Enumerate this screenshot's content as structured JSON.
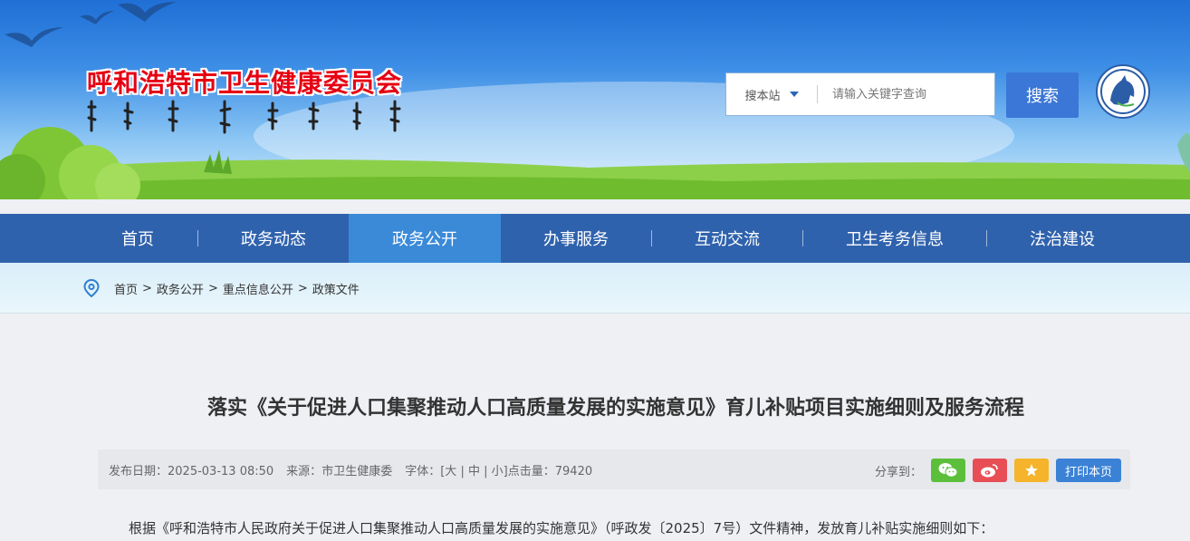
{
  "header": {
    "site_title": "呼和浩特市卫生健康委员会",
    "search": {
      "scope_label": "搜本站",
      "placeholder": "请输入关键字查询",
      "button_label": "搜索"
    }
  },
  "nav": {
    "items": [
      {
        "label": "首页"
      },
      {
        "label": "政务动态"
      },
      {
        "label": "政务公开"
      },
      {
        "label": "办事服务"
      },
      {
        "label": "互动交流"
      },
      {
        "label": "卫生考务信息"
      },
      {
        "label": "法治建设"
      }
    ],
    "active": "政务公开"
  },
  "breadcrumb": [
    "首页",
    "政务公开",
    "重点信息公开",
    "政策文件"
  ],
  "breadcrumb_sep": ">",
  "article": {
    "title": "落实《关于促进人口集聚推动人口高质量发展的实施意见》育儿补贴项目实施细则及服务流程",
    "meta": {
      "date_label": "发布日期：",
      "date": "2025-03-13 08:50",
      "source_label": "来源：",
      "source": "市卫生健康委",
      "font_label": "字体：",
      "size_large": "大",
      "size_medium": "中",
      "size_small": "小",
      "views_label": "点击量：",
      "views": "79420"
    },
    "share_label": "分享到：",
    "print_label": "打印本页",
    "first_paragraph": "根据《呼和浩特市人民政府关于促进人口集聚推动人口高质量发展的实施意见》（呼政发〔2025〕7号）文件精神，发放育儿补贴实施细则如下："
  },
  "colors": {
    "nav_bg": "#2f62ad",
    "nav_active": "#3a8ad8",
    "title_red": "#e60012",
    "search_button": "#3b77d6"
  }
}
